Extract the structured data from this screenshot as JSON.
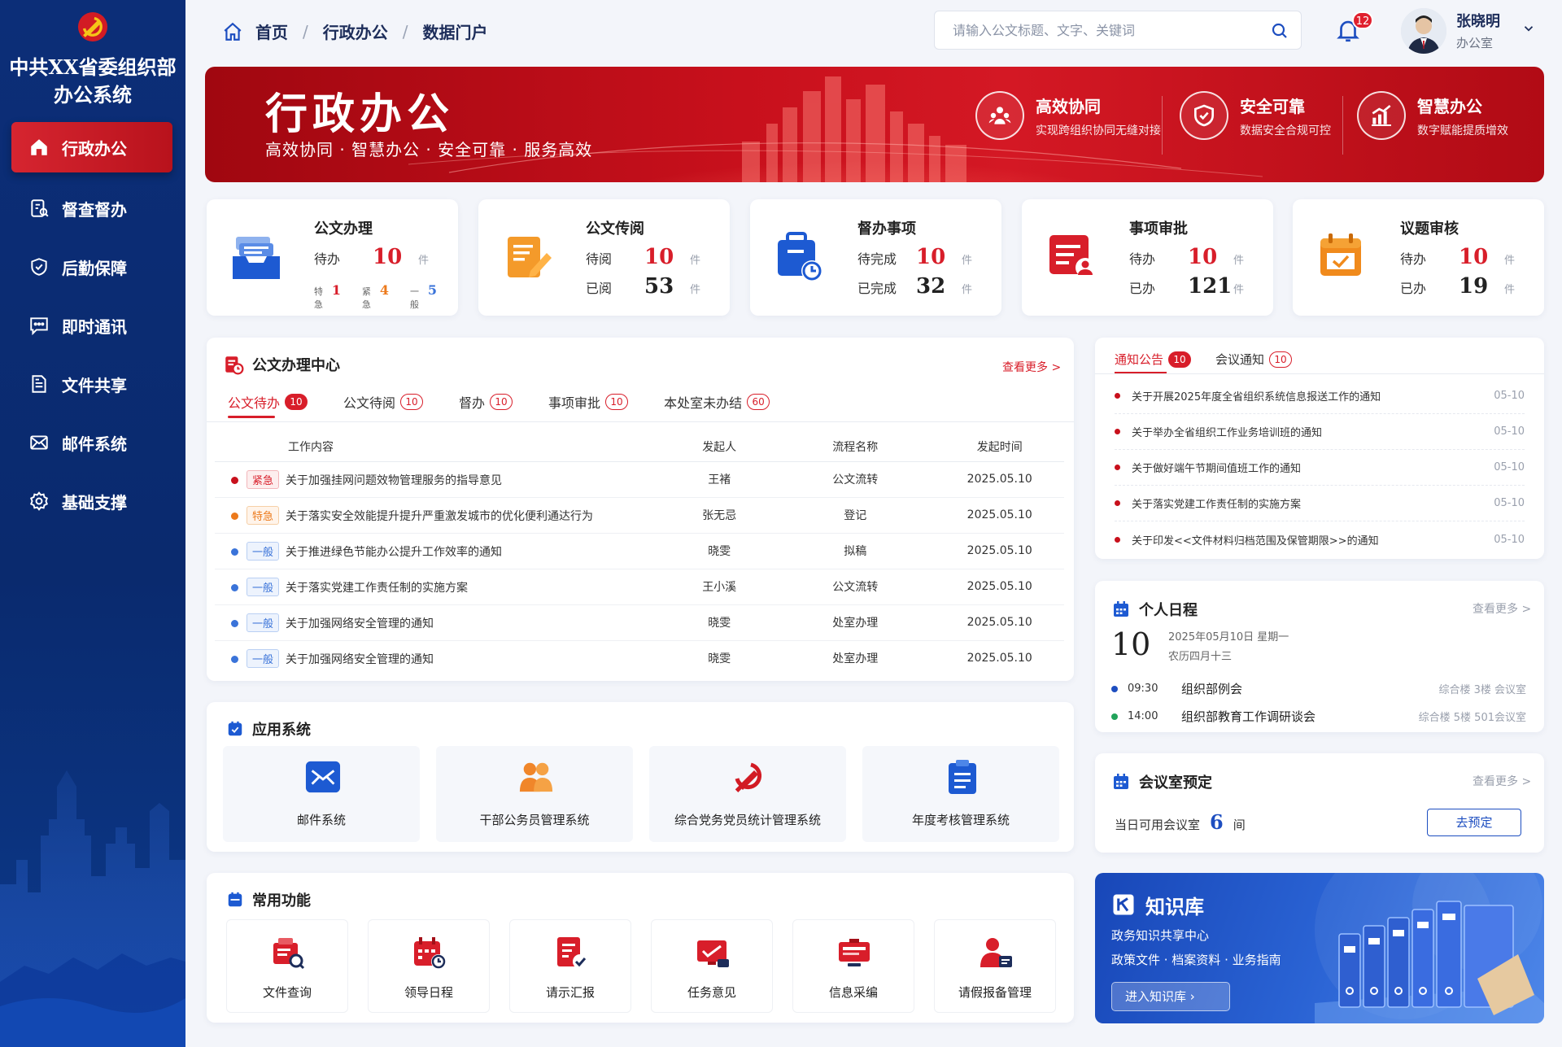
{
  "sidebar": {
    "org_name": "中共XX省委组织部\n办公系统",
    "items": [
      {
        "label": "行政办公",
        "icon": "home-icon",
        "active": true
      },
      {
        "label": "督查督办",
        "icon": "inspection-icon"
      },
      {
        "label": "后勤保障",
        "icon": "shield-icon"
      },
      {
        "label": "即时通讯",
        "icon": "chat-icon"
      },
      {
        "label": "文件共享",
        "icon": "file-share-icon"
      },
      {
        "label": "邮件系统",
        "icon": "mail-icon"
      },
      {
        "label": "基础支撑",
        "icon": "gear-icon"
      }
    ]
  },
  "header": {
    "breadcrumb": [
      "首页",
      "行政办公",
      "数据门户"
    ],
    "search_placeholder": "请输入公文标题、文字、关键词",
    "notification_count": "12",
    "user_name": "张晓明",
    "user_dept": "办公室"
  },
  "banner": {
    "title": "行政办公",
    "subtitle": "高效协同 · 智慧办公 · 安全可靠 · 服务高效",
    "features": [
      {
        "title": "高效协同",
        "desc": "实现跨组织协同无缝对接",
        "icon": "collaboration-icon"
      },
      {
        "title": "安全可靠",
        "desc": "数据安全合规可控",
        "icon": "shield-check-icon"
      },
      {
        "title": "智慧办公",
        "desc": "数字赋能提质增效",
        "icon": "chart-icon"
      }
    ]
  },
  "stats": [
    {
      "title": "公文办理",
      "r1_label": "待办",
      "r1_value": "10",
      "unit": "件",
      "mini": [
        {
          "label": "特急",
          "value": "1",
          "color": "#d81e2a"
        },
        {
          "label": "紧急",
          "value": "4",
          "color": "#ec7a1c"
        },
        {
          "label": "一般",
          "value": "5",
          "color": "#3a73d9"
        }
      ]
    },
    {
      "title": "公文传阅",
      "r1_label": "待阅",
      "r1_value": "10",
      "r2_label": "已阅",
      "r2_value": "53",
      "unit": "件"
    },
    {
      "title": "督办事项",
      "r1_label": "待完成",
      "r1_value": "10",
      "r2_label": "已完成",
      "r2_value": "32",
      "unit": "件"
    },
    {
      "title": "事项审批",
      "r1_label": "待办",
      "r1_value": "10",
      "r2_label": "已办",
      "r2_value": "121",
      "unit": "件"
    },
    {
      "title": "议题审核",
      "r1_label": "待办",
      "r1_value": "10",
      "r2_label": "已办",
      "r2_value": "19",
      "unit": "件"
    }
  ],
  "doc_center": {
    "title": "公文办理中心",
    "more": "查看更多 >",
    "tabs": [
      {
        "label": "公文待办",
        "count": "10"
      },
      {
        "label": "公文待阅",
        "count": "10"
      },
      {
        "label": "督办",
        "count": "10"
      },
      {
        "label": "事项审批",
        "count": "10"
      },
      {
        "label": "本处室未办结",
        "count": "60"
      }
    ],
    "columns": [
      "工作内容",
      "发起人",
      "流程名称",
      "发起时间"
    ],
    "rows": [
      {
        "level": "紧急",
        "kind": "urgent",
        "title": "关于加强挂网问题效物管理服务的指导意见",
        "initiator": "王褚",
        "flow": "公文流转",
        "time": "2025.05.10"
      },
      {
        "level": "特急",
        "kind": "special",
        "title": "关于落实安全效能提升提升严重激发城市的优化便利通达行为",
        "initiator": "张无忌",
        "flow": "登记",
        "time": "2025.05.10"
      },
      {
        "level": "一般",
        "kind": "normal",
        "title": "关于推进绿色节能办公提升工作效率的通知",
        "initiator": "晓雯",
        "flow": "拟稿",
        "time": "2025.05.10"
      },
      {
        "level": "一般",
        "kind": "normal",
        "title": "关于落实党建工作责任制的实施方案",
        "initiator": "王小溪",
        "flow": "公文流转",
        "time": "2025.05.10"
      },
      {
        "level": "一般",
        "kind": "normal",
        "title": "关于加强网络安全管理的通知",
        "initiator": "晓雯",
        "flow": "处室办理",
        "time": "2025.05.10"
      },
      {
        "level": "一般",
        "kind": "normal",
        "title": "关于加强网络安全管理的通知",
        "initiator": "晓雯",
        "flow": "处室办理",
        "time": "2025.05.10"
      }
    ]
  },
  "notices": {
    "tabs": [
      {
        "label": "通知公告",
        "count": "10"
      },
      {
        "label": "会议通知",
        "count": "10"
      }
    ],
    "items": [
      {
        "title": "关于开展2025年度全省组织系统信息报送工作的通知",
        "date": "05-10"
      },
      {
        "title": "关于举办全省组织工作业务培训班的通知",
        "date": "05-10"
      },
      {
        "title": "关于做好端午节期间值班工作的通知",
        "date": "05-10"
      },
      {
        "title": "关于落实党建工作责任制的实施方案",
        "date": "05-10"
      },
      {
        "title": "关于印发<<文件材料归档范围及保管期限>>的通知",
        "date": "05-10"
      }
    ]
  },
  "apps": {
    "title": "应用系统",
    "items": [
      {
        "label": "邮件系统",
        "icon": "mail-icon"
      },
      {
        "label": "干部公务员管理系统",
        "icon": "people-icon"
      },
      {
        "label": "综合党务党员统计管理系统",
        "icon": "party-emblem-icon"
      },
      {
        "label": "年度考核管理系统",
        "icon": "clipboard-icon"
      }
    ]
  },
  "functions": {
    "title": "常用功能",
    "items": [
      {
        "label": "文件查询",
        "icon": "file-search-icon"
      },
      {
        "label": "领导日程",
        "icon": "calendar-clock-icon"
      },
      {
        "label": "请示汇报",
        "icon": "report-check-icon"
      },
      {
        "label": "任务意见",
        "icon": "task-video-icon"
      },
      {
        "label": "信息采编",
        "icon": "info-edit-icon"
      },
      {
        "label": "请假报备管理",
        "icon": "user-leave-icon"
      }
    ]
  },
  "schedule": {
    "title": "个人日程",
    "more": "查看更多 >",
    "day": "10",
    "date": "2025年05月10日   星期一",
    "lunar": "农历四月十三",
    "items": [
      {
        "time": "09:30",
        "name": "组织部例会",
        "location": "综合楼  3楼  会议室",
        "color": "#1d4ec0"
      },
      {
        "time": "14:00",
        "name": "组织部教育工作调研谈会",
        "location": "综合楼  5楼  501会议室",
        "color": "#22a35a"
      }
    ]
  },
  "meeting_room": {
    "title": "会议室预定",
    "more": "查看更多 >",
    "label": "当日可用会议室",
    "count": "6",
    "unit": "间",
    "button": "去预定"
  },
  "knowledge": {
    "title": "知识库",
    "line1": "政务知识共享中心",
    "line2": "政策文件 · 档案资料 · 业务指南",
    "button": "进入知识库  ›"
  }
}
